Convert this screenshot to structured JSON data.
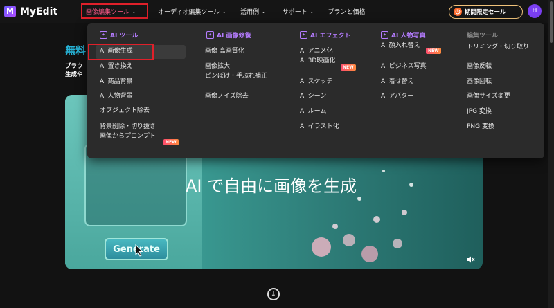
{
  "app": {
    "logo_mark": "M",
    "name": "MyEdit"
  },
  "nav": {
    "items": [
      {
        "label": "画像編集ツール",
        "chevron": "⌄"
      },
      {
        "label": "オーディオ編集ツール",
        "chevron": "⌄"
      },
      {
        "label": "活用例",
        "chevron": "⌄"
      },
      {
        "label": "サポート",
        "chevron": "⌄"
      },
      {
        "label": "プランと価格"
      }
    ],
    "sale_label": "期間限定セール",
    "avatar_initial": "H"
  },
  "hero": {
    "title": "無料",
    "subtitle_line1": "ブラウ",
    "subtitle_line2": "生成や",
    "video_overlay": "AI で自由に画像を生成",
    "generate_label": "Generate"
  },
  "dropdown": {
    "columns": [
      {
        "heading": "AI ツール",
        "items": [
          "AI 画像生成",
          "AI 置き換え",
          "AI 商品背景",
          "AI 人物背景",
          "オブジェクト除去",
          "背景削除・切り抜き",
          "画像からプロンプト"
        ]
      },
      {
        "heading": "AI 画像修復",
        "items": [
          "画像 高画質化",
          "画像拡大",
          "ピンぼけ・手ぶれ補正",
          "画像ノイズ除去"
        ]
      },
      {
        "heading": "AI エフェクト",
        "items": [
          "AI アニメ化",
          "AI 3D映画化",
          "AI スケッチ",
          "AI シーン",
          "AI ルーム",
          "AI イラスト化"
        ]
      },
      {
        "heading": "AI 人物写真",
        "items": [
          "AI 顔入れ替え",
          "AI ビジネス写真",
          "AI 着せ替え",
          "AI アバター"
        ]
      },
      {
        "heading": "編集ツール",
        "items": [
          "トリミング・切り取り",
          "画像反転",
          "画像回転",
          "画像サイズ変更",
          "JPG 変換",
          "PNG 変換"
        ]
      }
    ],
    "new_badge": "NEW"
  },
  "colors": {
    "accent": "#b57cff",
    "highlight_box": "#e0202a",
    "hero_title": "#27b4d8"
  },
  "icons": {
    "down": "↓",
    "mute": "🔇",
    "star": "✦"
  }
}
